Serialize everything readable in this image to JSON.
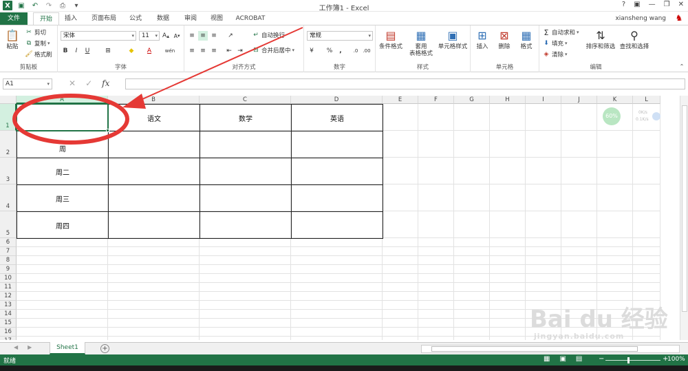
{
  "window": {
    "title": "工作簿1 - Excel",
    "user": "xiansheng wang"
  },
  "tabs": [
    {
      "label": "文件"
    },
    {
      "label": "开始"
    },
    {
      "label": "插入"
    },
    {
      "label": "页面布局"
    },
    {
      "label": "公式"
    },
    {
      "label": "数据"
    },
    {
      "label": "审阅"
    },
    {
      "label": "视图"
    },
    {
      "label": "ACROBAT"
    }
  ],
  "ribbon": {
    "clipboard": {
      "paste": "粘贴",
      "cut": "剪切",
      "copy": "复制",
      "format_painter": "格式刷",
      "label": "剪贴板"
    },
    "font": {
      "name": "宋体",
      "size": "11",
      "label": "字体",
      "bold": "B",
      "italic": "I",
      "underline": "U",
      "grow": "A",
      "shrink": "A",
      "color": "A"
    },
    "alignment": {
      "wrap": "自动换行",
      "merge": "合并后居中",
      "label": "对齐方式"
    },
    "number": {
      "format": "常规",
      "percent": "%",
      "comma": ",",
      "label": "数字"
    },
    "styles": {
      "conditional": "条件格式",
      "table1": "套用",
      "table2": "表格格式",
      "cell": "单元格样式",
      "label": "样式"
    },
    "cells": {
      "insert": "插入",
      "delete": "删除",
      "format": "格式",
      "label": "单元格"
    },
    "editing": {
      "autosum": "自动求和",
      "fill": "填充",
      "clear": "清除",
      "sort": "排序和筛选",
      "find": "查找和选择",
      "label": "编辑"
    }
  },
  "formula_bar": {
    "name_box": "A1",
    "fx": "fx",
    "cancel": "✕",
    "enter": "✓"
  },
  "columns": [
    "A",
    "B",
    "C",
    "D",
    "E",
    "F",
    "G",
    "H",
    "I",
    "J",
    "K",
    "L"
  ],
  "rows": [
    "1",
    "2",
    "3",
    "4",
    "5",
    "6",
    "7",
    "8",
    "9",
    "10",
    "11",
    "12",
    "13",
    "14",
    "15",
    "16",
    "17"
  ],
  "table": {
    "header": [
      "",
      "语文",
      "数学",
      "英语"
    ],
    "row_labels": [
      "周",
      "周二",
      "周三",
      "周四"
    ]
  },
  "sheet": {
    "tab": "Sheet1",
    "add": "+"
  },
  "status": {
    "ready": "就绪",
    "zoom": "100%"
  },
  "widget": {
    "percent": "60%",
    "up": "0K/s",
    "down": "0.1K/s"
  },
  "watermark": {
    "main": "Bai du 经验",
    "sub": "jingyan.baidu.com"
  },
  "colors": {
    "accent": "#217346",
    "annotation": "#e53935"
  }
}
